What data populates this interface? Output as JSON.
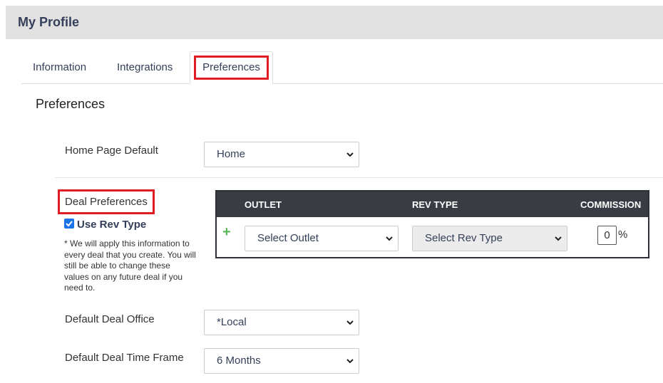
{
  "header": {
    "title": "My Profile"
  },
  "tabs": [
    {
      "label": "Information"
    },
    {
      "label": "Integrations"
    },
    {
      "label": "Preferences"
    }
  ],
  "section_title": "Preferences",
  "home_page": {
    "label": "Home Page Default",
    "value": "Home"
  },
  "deal_preferences": {
    "label": "Deal Preferences",
    "use_rev_type_label": "Use Rev Type",
    "use_rev_type_checked": true,
    "note": "* We will apply this information to every deal that you create. You will still be able to change these values on any future deal if you need to."
  },
  "deal_table": {
    "headers": {
      "outlet": "OUTLET",
      "rev_type": "REV TYPE",
      "commission": "COMMISSION"
    },
    "row": {
      "outlet": "Select Outlet",
      "rev_type": "Select Rev Type",
      "commission": "0",
      "commission_unit": "%"
    }
  },
  "default_office": {
    "label": "Default Deal Office",
    "value": "*Local"
  },
  "default_time_frame": {
    "label": "Default Deal Time Frame",
    "value": "6 Months"
  },
  "colors": {
    "highlight": "#e11b22",
    "header_bg": "#393c42",
    "accent": "#34405a",
    "add": "#5cb85c"
  },
  "icons": [
    "chevron-down-icon",
    "check-icon",
    "plus-icon"
  ]
}
